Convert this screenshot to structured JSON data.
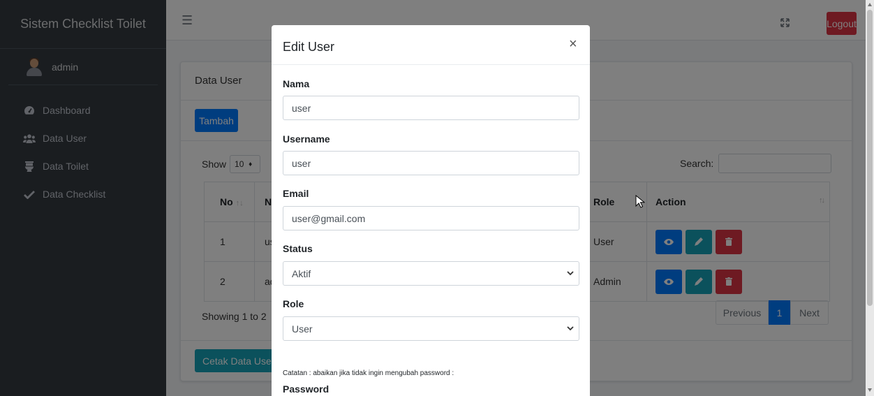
{
  "sidebar": {
    "brand": "Sistem Checklist Toilet",
    "user": "admin",
    "items": [
      {
        "label": "Dashboard",
        "icon": "tachometer-icon"
      },
      {
        "label": "Data User",
        "icon": "users-icon"
      },
      {
        "label": "Data Toilet",
        "icon": "toilet-icon"
      },
      {
        "label": "Data Checklist",
        "icon": "check-icon"
      }
    ]
  },
  "topbar": {
    "logout": "Logout"
  },
  "card": {
    "title": "Data User",
    "add_button": "Tambah",
    "show_label": "Show",
    "show_value": "10",
    "search_label": "Search:",
    "columns": [
      "No",
      "Na",
      "Role",
      "Action"
    ],
    "rows": [
      {
        "no": "1",
        "name": "us",
        "role": "User"
      },
      {
        "no": "2",
        "name": "ad",
        "role": "Admin"
      }
    ],
    "showing": "Showing 1 to 2",
    "pager": {
      "prev": "Previous",
      "current": "1",
      "next": "Next"
    },
    "print_button": "Cetak Data Use"
  },
  "modal": {
    "title": "Edit User",
    "close": "×",
    "fields": {
      "nama_label": "Nama",
      "nama_value": "user",
      "username_label": "Username",
      "username_value": "user",
      "email_label": "Email",
      "email_value": "user@gmail.com",
      "status_label": "Status",
      "status_value": "Aktif",
      "role_label": "Role",
      "role_value": "User"
    },
    "note": "Catatan : abaikan jika tidak ingin mengubah password :",
    "password_label": "Password"
  },
  "colors": {
    "sidebar": "#343a40",
    "primary": "#007bff",
    "info": "#17a2b8",
    "danger": "#dc3545"
  }
}
